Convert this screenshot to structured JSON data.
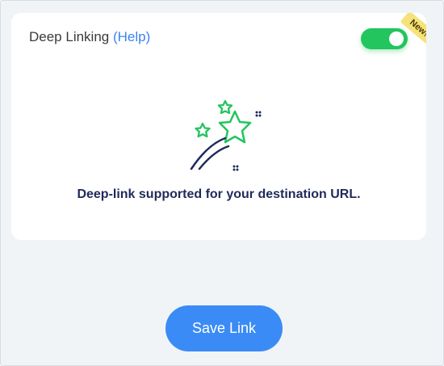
{
  "deep_linking": {
    "label": "Deep Linking",
    "help_link": "(Help)",
    "toggle_on": true,
    "new_badge": "New!",
    "message": "Deep-link supported for your destination URL."
  },
  "actions": {
    "save_label": "Save Link"
  },
  "colors": {
    "accent_blue": "#3b8bf6",
    "toggle_green": "#22c55e",
    "badge_yellow": "#f6e27a",
    "message_navy": "#1f2a5a"
  },
  "icons": {
    "illustration": "shooting-stars-icon"
  }
}
